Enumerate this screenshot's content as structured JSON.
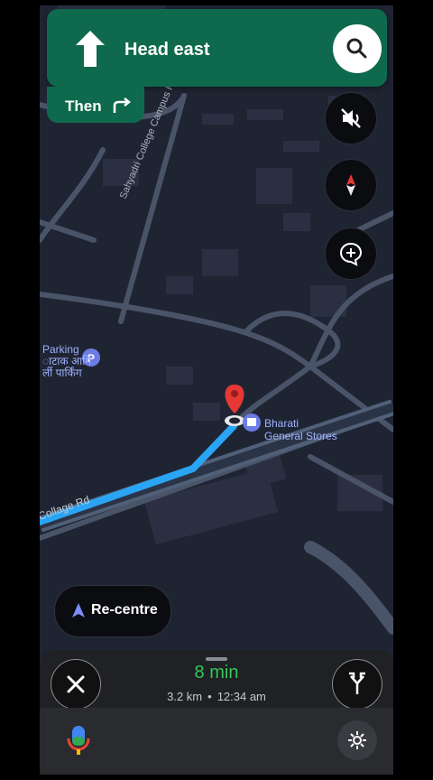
{
  "navigation": {
    "instruction": "Head east",
    "then_label": "Then",
    "then_maneuver": "turn-right-icon",
    "primary_maneuver": "straight-arrow-icon"
  },
  "controls": {
    "search_icon": "search-icon",
    "mute_icon": "volume-off-icon",
    "compass_icon": "compass-icon",
    "report_icon": "add-report-icon"
  },
  "map": {
    "labels": {
      "parking_en": "Parking",
      "parking_local1": "ाटाक आगि",
      "parking_local2": "र्ली पार्किंग",
      "store_line1": "Bharati",
      "store_line2": "General Stores",
      "road_top": "Sahyadri College Campus Rd",
      "road_bottom": "Collage Rd"
    }
  },
  "recentre": {
    "label": "Re-centre"
  },
  "trip": {
    "eta_minutes": "8 min",
    "distance": "3.2 km",
    "arrival": "12:34 am",
    "separator": "•"
  },
  "colors": {
    "banner": "#0f6a4d",
    "route": "#2aa4f4",
    "eta": "#34c759",
    "map_bg": "#1f2433"
  }
}
